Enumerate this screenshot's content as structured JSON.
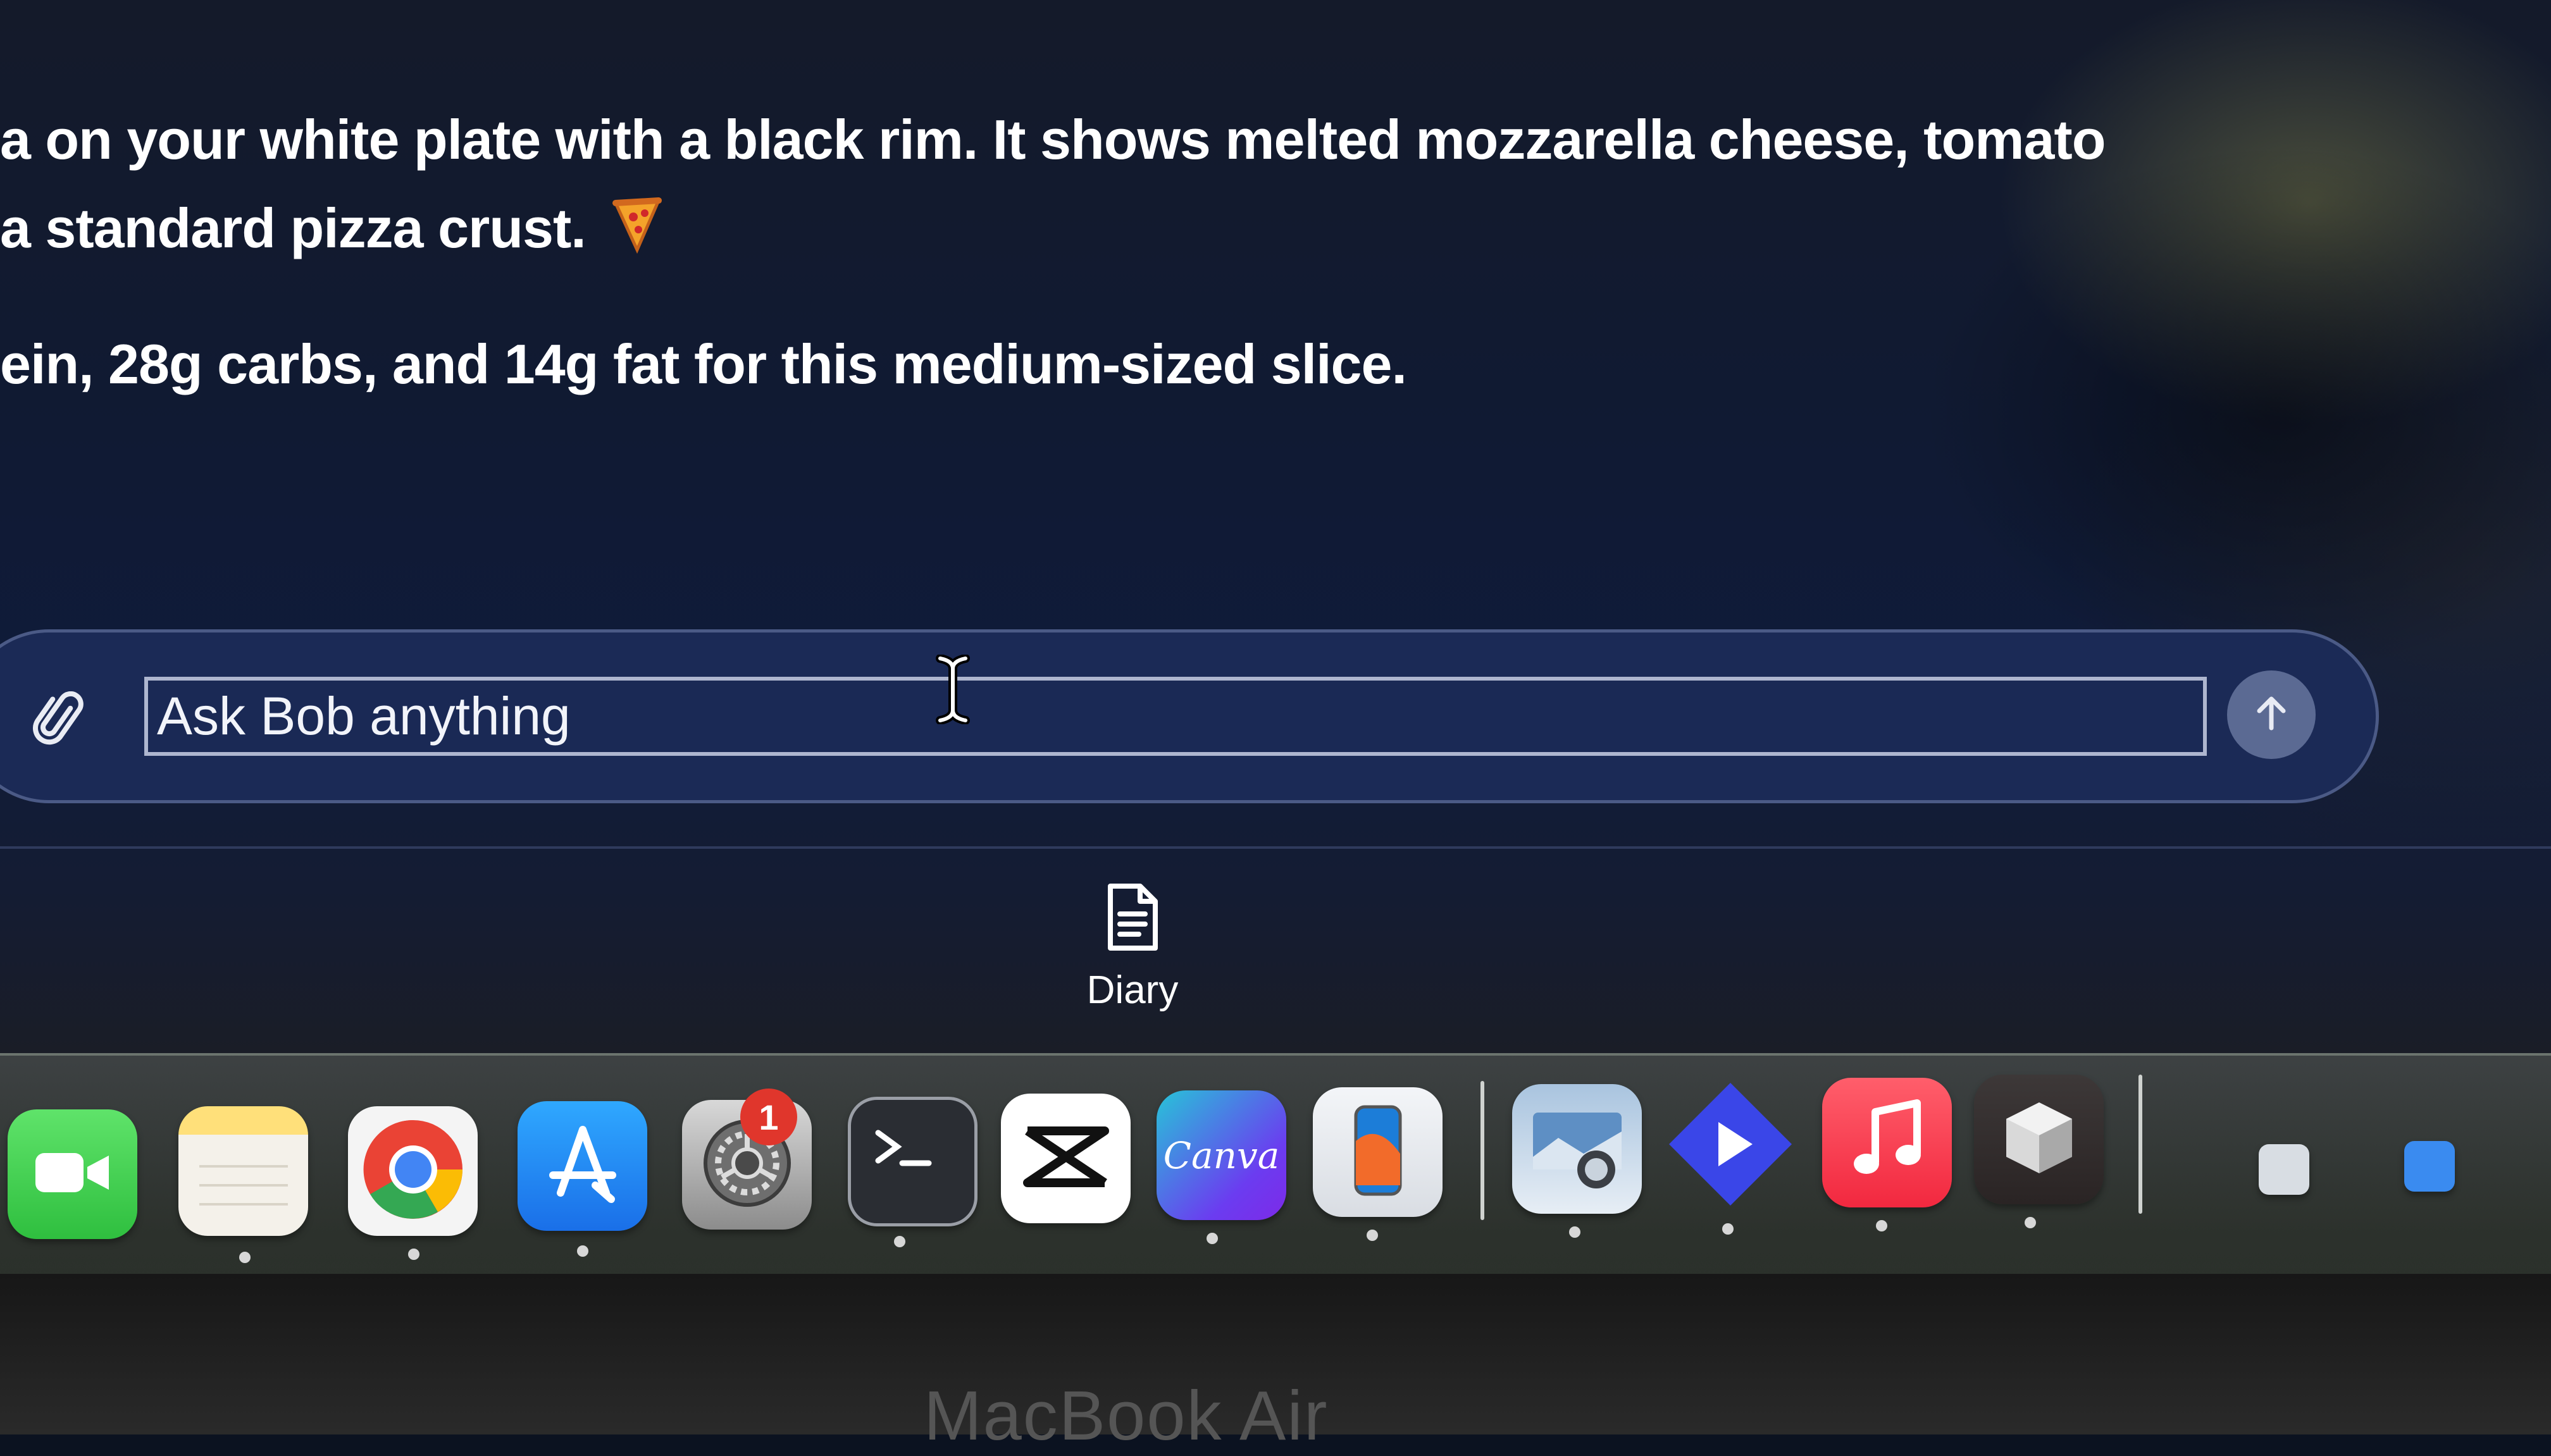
{
  "messages": [
    "a on your white plate with a black rim. It shows melted mozzarella cheese, tomato",
    "a standard pizza crust.",
    "ein, 28g carbs, and 14g fat for this medium-sized slice."
  ],
  "input": {
    "placeholder": "Ask Bob anything"
  },
  "shortcuts": {
    "diary_label": "Diary"
  },
  "dock": {
    "apps": [
      "facetime",
      "notes",
      "chrome",
      "app-store",
      "system-settings",
      "terminal",
      "capcut",
      "canva",
      "iphone-mirroring",
      "preview",
      "infuse",
      "music",
      "unknown-app"
    ],
    "settings_badge": "1",
    "canva_label": "Canva"
  },
  "laptop_label": "MacBook Air",
  "colors": {
    "panel": "#1b2a56",
    "input_border": "#aeb6cf",
    "send_button": "#5b6a93"
  }
}
